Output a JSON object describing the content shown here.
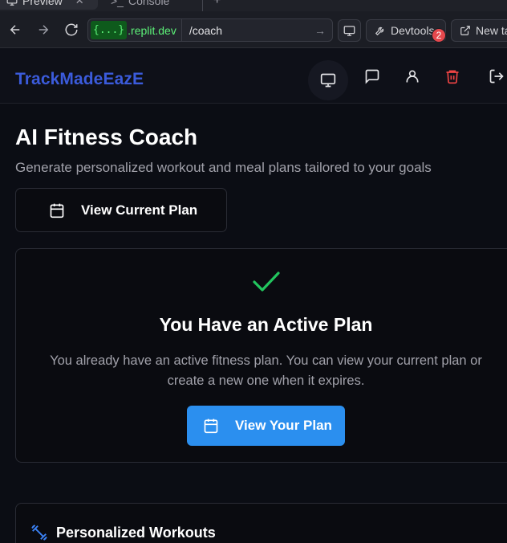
{
  "browser": {
    "tabs": [
      {
        "label": "Preview",
        "active": true
      },
      {
        "label": "Console",
        "active": false
      }
    ],
    "url_chip": "{...}",
    "url_domain": ".replit.dev",
    "url_path": "/coach",
    "devtools_label": "Devtools",
    "devtools_badge": "2",
    "newtab_label": "New ta"
  },
  "app": {
    "brand": "TrackMadeEazE",
    "header_icons": [
      "monitor-icon",
      "chat-icon",
      "user-icon",
      "trash-icon",
      "logout-icon"
    ],
    "colors": {
      "brand": "#3b5bdb",
      "primary": "#2b8fef",
      "success": "#22c55e",
      "danger": "#ef4444"
    }
  },
  "main": {
    "title": "AI Fitness Coach",
    "subtitle": "Generate personalized workout and meal plans tailored to your goals",
    "view_current_plan": "View Current Plan",
    "active_card": {
      "title": "You Have an Active Plan",
      "text": "You already have an active fitness plan. You can view your current plan or create a new one when it expires.",
      "button": "View Your Plan"
    },
    "section": {
      "title": "Personalized Workouts"
    }
  }
}
